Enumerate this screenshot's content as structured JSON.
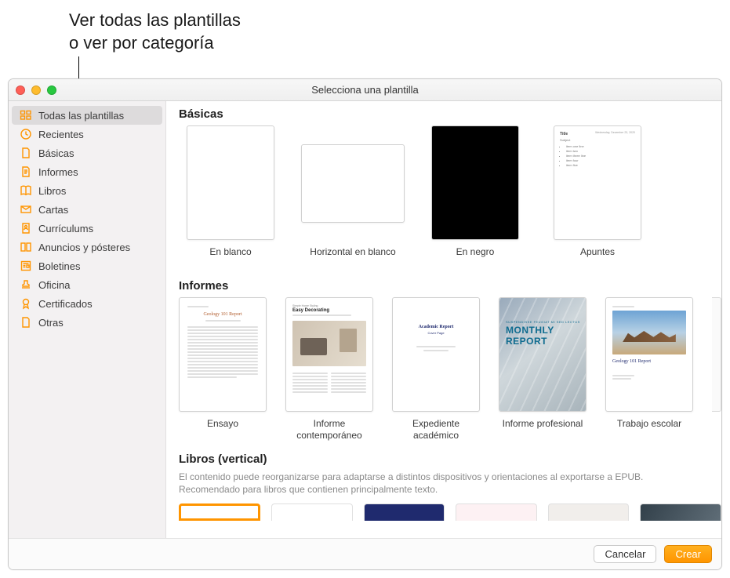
{
  "callout": {
    "line1": "Ver todas las plantillas",
    "line2": "o ver por categoría"
  },
  "window": {
    "title": "Selecciona una plantilla"
  },
  "sidebar": {
    "items": [
      {
        "label": "Todas las plantillas",
        "icon": "grid",
        "selected": true
      },
      {
        "label": "Recientes",
        "icon": "clock",
        "selected": false
      },
      {
        "label": "Básicas",
        "icon": "doc",
        "selected": false
      },
      {
        "label": "Informes",
        "icon": "doc-text",
        "selected": false
      },
      {
        "label": "Libros",
        "icon": "book",
        "selected": false
      },
      {
        "label": "Cartas",
        "icon": "envelope",
        "selected": false
      },
      {
        "label": "Currículums",
        "icon": "person-doc",
        "selected": false
      },
      {
        "label": "Anuncios y pósteres",
        "icon": "spread",
        "selected": false
      },
      {
        "label": "Boletines",
        "icon": "news",
        "selected": false
      },
      {
        "label": "Oficina",
        "icon": "stamp",
        "selected": false
      },
      {
        "label": "Certificados",
        "icon": "ribbon",
        "selected": false
      },
      {
        "label": "Otras",
        "icon": "doc",
        "selected": false
      }
    ]
  },
  "sections": {
    "basicas": {
      "title": "Básicas",
      "templates": [
        {
          "label": "En blanco"
        },
        {
          "label": "Horizontal en blanco"
        },
        {
          "label": "En negro"
        },
        {
          "label": "Apuntes"
        }
      ]
    },
    "informes": {
      "title": "Informes",
      "templates": [
        {
          "label": "Ensayo"
        },
        {
          "label": "Informe contemporáneo"
        },
        {
          "label": "Expediente académico"
        },
        {
          "label": "Informe profesional"
        },
        {
          "label": "Trabajo escolar"
        }
      ],
      "thumb_text": {
        "ensayo_title": "Geology 101 Report",
        "contemp_small": "Simple Home Styling",
        "contemp_big": "Easy Decorating",
        "acad_title": "Academic Report",
        "acad_sub": "Cover Page",
        "prof_small": "SUSPENDISSE FEUGIAT MI SED LECTUS",
        "prof_big1": "MONTHLY",
        "prof_big2": "REPORT",
        "escolar_title": "Geology 101 Report"
      }
    },
    "libros": {
      "title": "Libros (vertical)",
      "description": "El contenido puede reorganizarse para adaptarse a distintos dispositivos y orientaciones al exportarse a EPUB. Recomendado para libros que contienen principalmente texto."
    }
  },
  "footer": {
    "cancel": "Cancelar",
    "create": "Crear"
  }
}
